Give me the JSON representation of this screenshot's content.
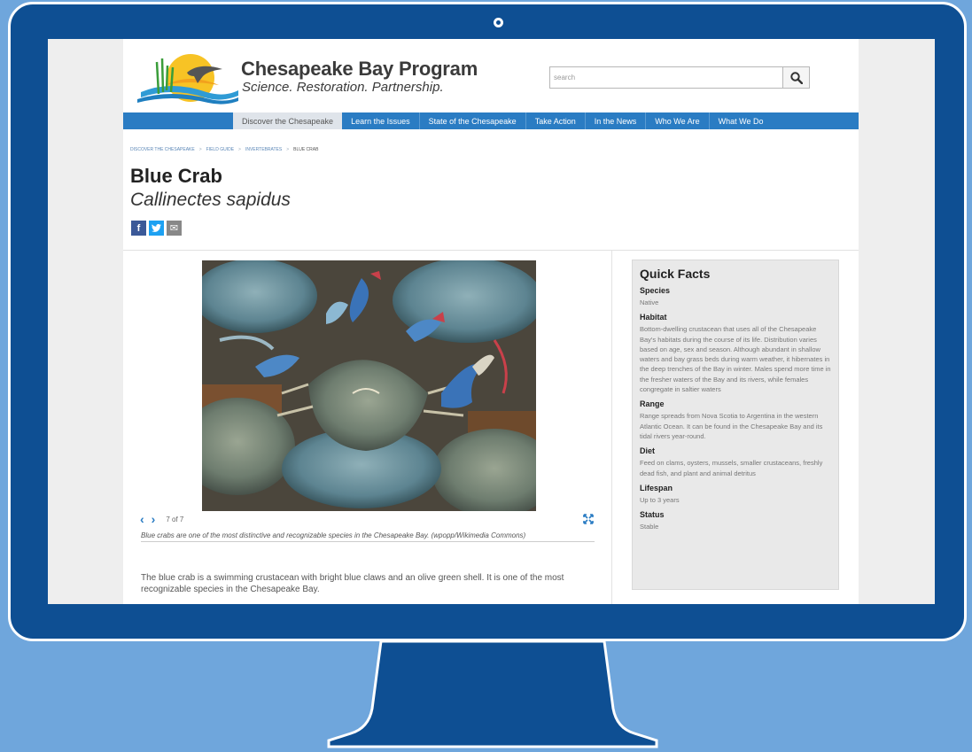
{
  "site": {
    "title": "Chesapeake Bay Program",
    "tagline": "Science. Restoration. Partnership."
  },
  "search": {
    "placeholder": "search"
  },
  "nav": {
    "items": [
      {
        "label": "Discover the Chesapeake",
        "active": true
      },
      {
        "label": "Learn the Issues"
      },
      {
        "label": "State of the Chesapeake"
      },
      {
        "label": "Take Action"
      },
      {
        "label": "In the News"
      },
      {
        "label": "Who We Are"
      },
      {
        "label": "What We Do"
      }
    ]
  },
  "breadcrumb": [
    "Discover the Chesapeake",
    "Field Guide",
    "Invertebrates",
    "Blue Crab"
  ],
  "breadcrumb_separator": ">",
  "page": {
    "title": "Blue Crab",
    "subtitle": "Callinectes sapidus"
  },
  "share": {
    "facebook": "f",
    "twitter": "t",
    "email": "✉"
  },
  "gallery": {
    "counter": "7 of 7",
    "prev_icon": "‹",
    "next_icon": "›",
    "caption": "Blue crabs are one of the most distinctive and recognizable species in the Chesapeake Bay. (wpopp/Wikimedia Commons)"
  },
  "body": {
    "intro": "The blue crab is a swimming crustacean with bright blue claws and an olive green shell. It is one of the most recognizable species in the Chesapeake Bay."
  },
  "quick_facts": {
    "title": "Quick Facts",
    "facts": [
      {
        "label": "Species",
        "value": "Native"
      },
      {
        "label": "Habitat",
        "value": "Bottom-dwelling crustacean that uses all of the Chesapeake Bay's habitats during the course of its life. Distribution varies based on age, sex and season. Although abundant in shallow waters and bay grass beds during warm weather, it hibernates in the deep trenches of the Bay in winter. Males spend more time in the fresher waters of the Bay and its rivers, while females congregate in saltier waters"
      },
      {
        "label": "Range",
        "value": "Range spreads from Nova Scotia to Argentina in the western Atlantic Ocean. It can be found in the Chesapeake Bay and its tidal rivers year-round."
      },
      {
        "label": "Diet",
        "value": "Feed on clams, oysters, mussels, smaller crustaceans, freshly dead fish, and plant and animal detritus"
      },
      {
        "label": "Lifespan",
        "value": "Up to 3 years"
      },
      {
        "label": "Status",
        "value": "Stable"
      }
    ]
  },
  "colors": {
    "background": "#6fa6dc",
    "monitor": "#0e4f93",
    "nav": "#2a7cc3",
    "link": "#2a7cc3"
  },
  "icons": [
    "search-icon",
    "chevron-left-icon",
    "chevron-right-icon",
    "expand-icon",
    "facebook-icon",
    "twitter-icon",
    "email-icon",
    "camera-dot-icon"
  ]
}
